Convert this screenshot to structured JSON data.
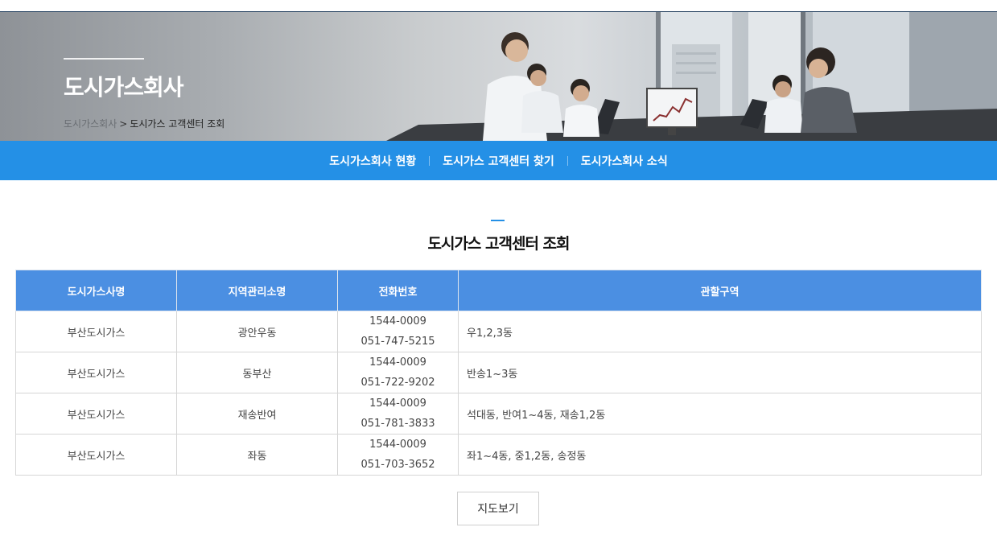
{
  "hero": {
    "title": "도시가스회사",
    "breadcrumb": {
      "home": "도시가스회사",
      "separator": ">",
      "current": "도시가스 고객센터 조회"
    }
  },
  "subnav": {
    "items": [
      {
        "label": "도시가스회사 현황"
      },
      {
        "label": "도시가스 고객센터 찾기"
      },
      {
        "label": "도시가스회사 소식"
      }
    ]
  },
  "section": {
    "title": "도시가스 고객센터 조회"
  },
  "table": {
    "headers": [
      "도시가스사명",
      "지역관리소명",
      "전화번호",
      "관할구역"
    ],
    "rows": [
      {
        "company": "부산도시가스",
        "office": "광안우동",
        "phone1": "1544-0009",
        "phone2": "051-747-5215",
        "area": "우1,2,3동"
      },
      {
        "company": "부산도시가스",
        "office": "동부산",
        "phone1": "1544-0009",
        "phone2": "051-722-9202",
        "area": "반송1~3동"
      },
      {
        "company": "부산도시가스",
        "office": "재송반여",
        "phone1": "1544-0009",
        "phone2": "051-781-3833",
        "area": "석대동, 반여1~4동, 재송1,2동"
      },
      {
        "company": "부산도시가스",
        "office": "좌동",
        "phone1": "1544-0009",
        "phone2": "051-703-3652",
        "area": "좌1~4동, 중1,2동, 송정동"
      }
    ]
  },
  "map_button": {
    "label": "지도보기"
  },
  "colors": {
    "nav_blue": "#2490e6",
    "header_blue": "#4b8fe2"
  }
}
